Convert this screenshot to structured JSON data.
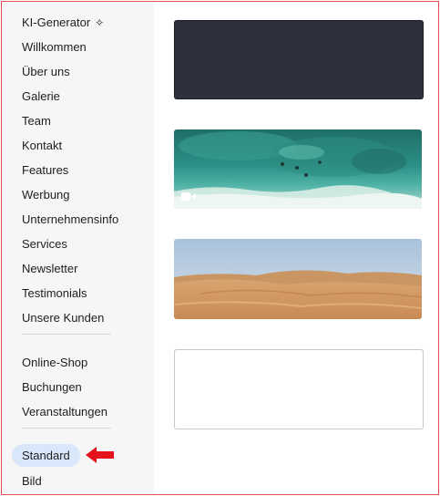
{
  "sidebar": {
    "items": [
      {
        "label": "KI-Generator"
      },
      {
        "label": "Willkommen"
      },
      {
        "label": "Über uns"
      },
      {
        "label": "Galerie"
      },
      {
        "label": "Team"
      },
      {
        "label": "Kontakt"
      },
      {
        "label": "Features"
      },
      {
        "label": "Werbung"
      },
      {
        "label": "Unternehmensinfo"
      },
      {
        "label": "Services"
      },
      {
        "label": "Newsletter"
      },
      {
        "label": "Testimonials"
      },
      {
        "label": "Unsere Kunden"
      }
    ],
    "group2": [
      {
        "label": "Online-Shop"
      },
      {
        "label": "Buchungen"
      },
      {
        "label": "Veranstaltungen"
      }
    ],
    "group3": [
      {
        "label": "Standard",
        "selected": true
      },
      {
        "label": "Bild"
      }
    ],
    "ki_icon": "sparkle-icon"
  },
  "thumbnails": [
    {
      "kind": "solid-dark",
      "color": "#2f303d"
    },
    {
      "kind": "video",
      "icon": "video-camera-icon",
      "scene": "aerial-beach"
    },
    {
      "kind": "image",
      "scene": "desert-dunes"
    },
    {
      "kind": "blank",
      "color": "#ffffff"
    }
  ],
  "colors": {
    "frame_border": "#e05050",
    "selected_pill": "#d9e7fa",
    "pointer_arrow": "#e3121b",
    "sidebar_bg": "#f6f6f6"
  }
}
